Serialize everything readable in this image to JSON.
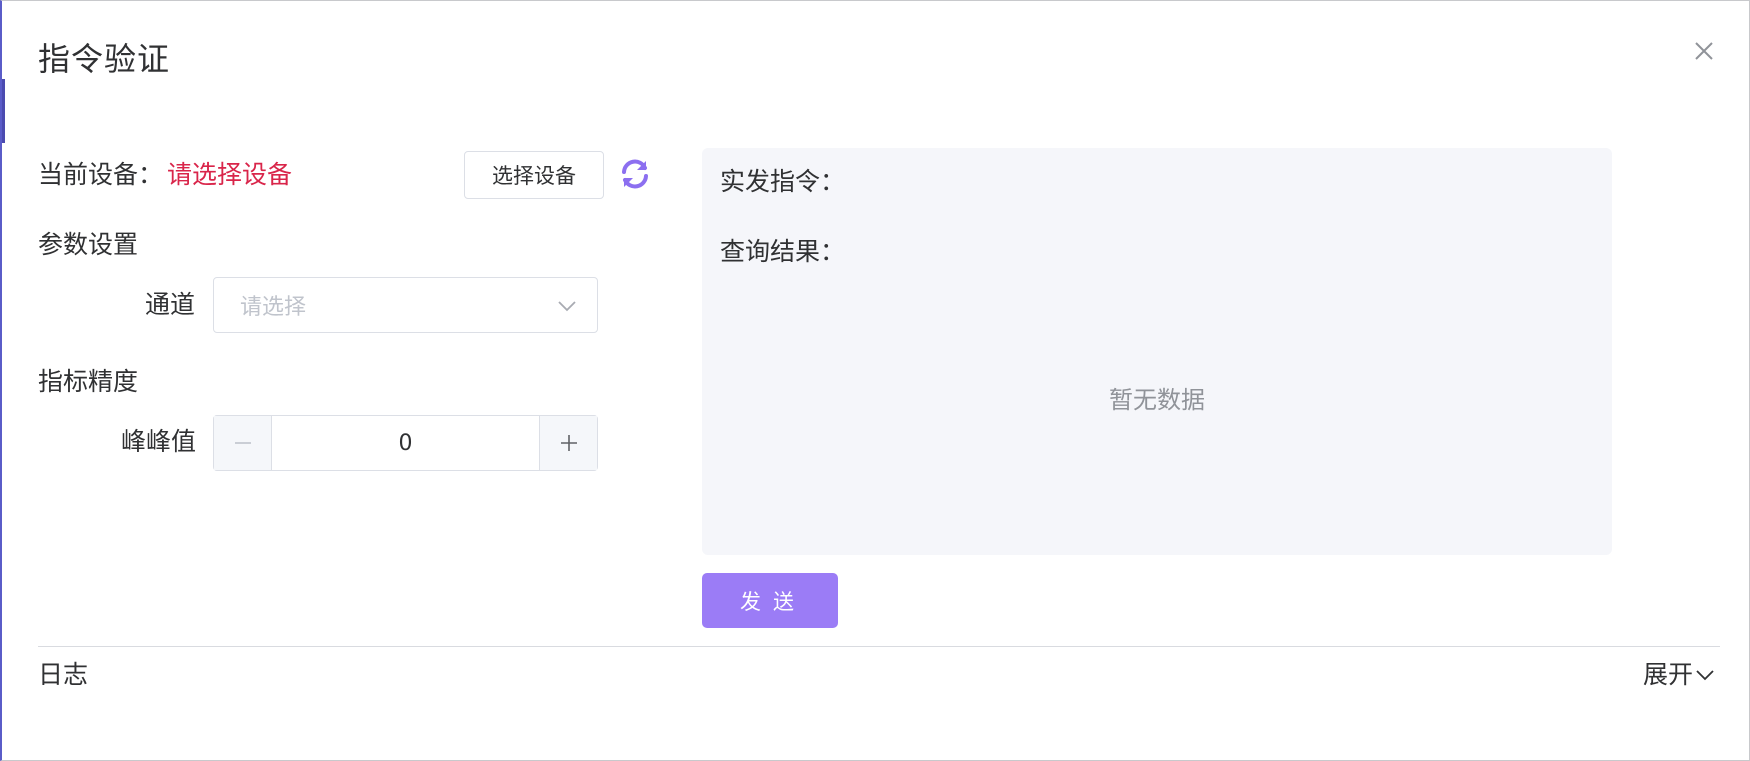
{
  "dialog": {
    "title": "指令验证"
  },
  "device": {
    "label": "当前设备：",
    "value": "请选择设备",
    "value_color": "#d9254a",
    "select_button": "选择设备",
    "refresh_icon": "refresh-icon"
  },
  "params": {
    "section_title": "参数设置",
    "channel_label": "通道",
    "channel_placeholder": "请选择"
  },
  "index": {
    "section_title": "指标精度",
    "peak_label": "峰峰值",
    "peak_value": "0"
  },
  "result": {
    "command_label": "实发指令：",
    "query_label": "查询结果：",
    "empty_text": "暂无数据"
  },
  "actions": {
    "send_label": "发送",
    "send_color": "#9b7cf6"
  },
  "log": {
    "label": "日志",
    "expand_label": "展开"
  }
}
